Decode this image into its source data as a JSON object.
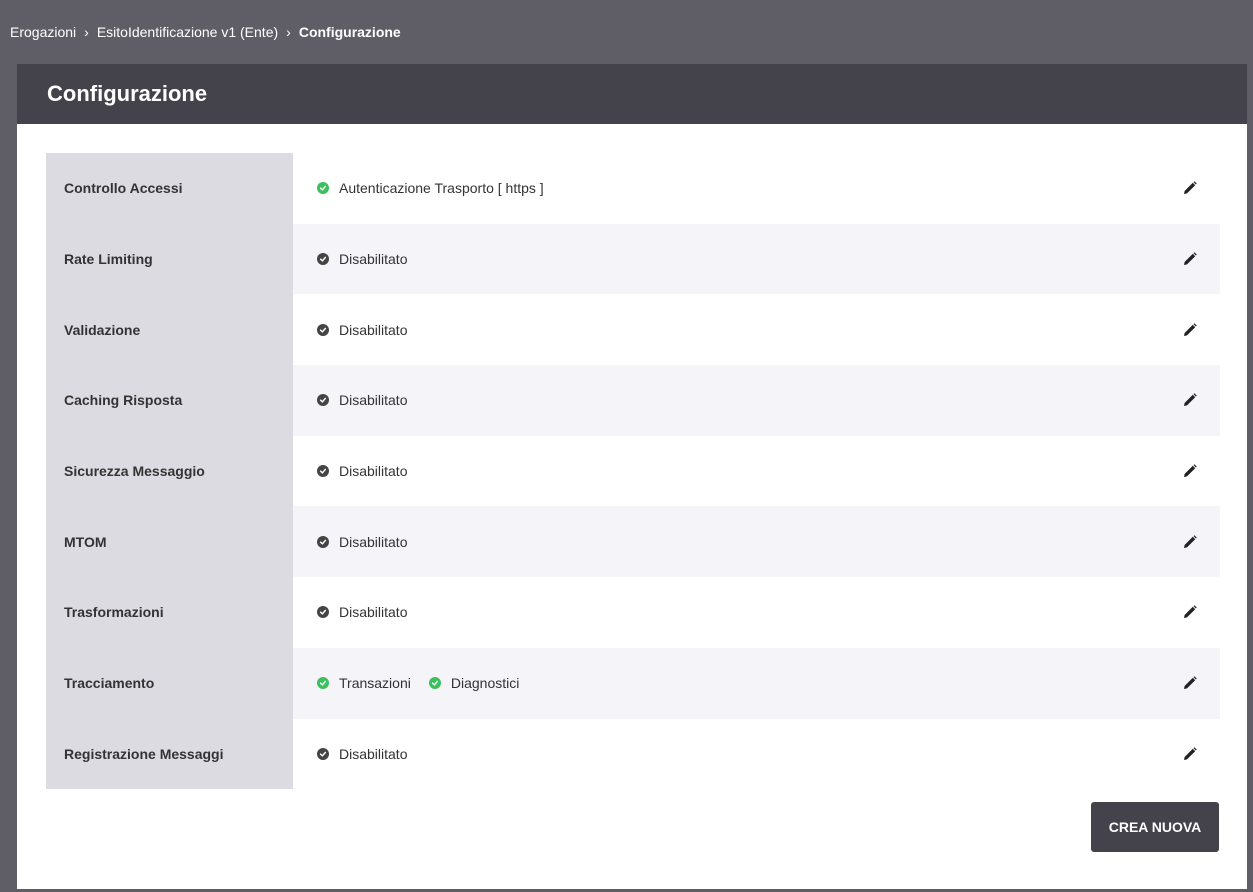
{
  "breadcrumb": {
    "items": [
      "Erogazioni",
      "EsitoIdentificazione v1 (Ente)"
    ],
    "current": "Configurazione",
    "separator": "›"
  },
  "panel": {
    "title": "Configurazione"
  },
  "rows": [
    {
      "label": "Controllo Accessi",
      "statuses": [
        {
          "text": "Autenticazione Trasporto [ https ]",
          "state": "enabled"
        }
      ]
    },
    {
      "label": "Rate Limiting",
      "statuses": [
        {
          "text": "Disabilitato",
          "state": "disabled"
        }
      ]
    },
    {
      "label": "Validazione",
      "statuses": [
        {
          "text": "Disabilitato",
          "state": "disabled"
        }
      ]
    },
    {
      "label": "Caching Risposta",
      "statuses": [
        {
          "text": "Disabilitato",
          "state": "disabled"
        }
      ]
    },
    {
      "label": "Sicurezza Messaggio",
      "statuses": [
        {
          "text": "Disabilitato",
          "state": "disabled"
        }
      ]
    },
    {
      "label": "MTOM",
      "statuses": [
        {
          "text": "Disabilitato",
          "state": "disabled"
        }
      ]
    },
    {
      "label": "Trasformazioni",
      "statuses": [
        {
          "text": "Disabilitato",
          "state": "disabled"
        }
      ]
    },
    {
      "label": "Tracciamento",
      "statuses": [
        {
          "text": "Transazioni",
          "state": "enabled"
        },
        {
          "text": "Diagnostici",
          "state": "enabled"
        }
      ]
    },
    {
      "label": "Registrazione Messaggi",
      "statuses": [
        {
          "text": "Disabilitato",
          "state": "disabled"
        }
      ]
    }
  ],
  "actions": {
    "create_label": "CREA NUOVA"
  },
  "colors": {
    "enabled": "#3cbf5d",
    "disabled": "#444444",
    "header_bg": "#44434b",
    "breadcrumb_bg": "#5f5e67"
  },
  "icons": {
    "row_action": "pencil-icon",
    "status": "check-circle-icon"
  }
}
